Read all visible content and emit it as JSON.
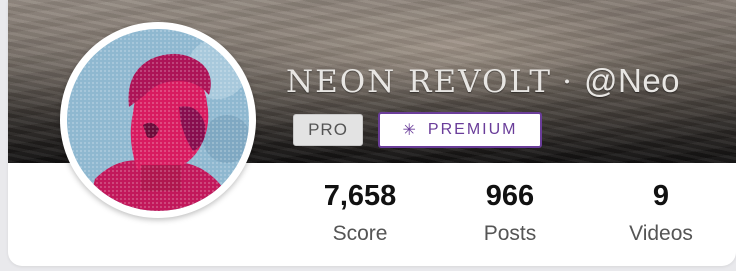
{
  "profile": {
    "display_name": "NEON REVOLT",
    "separator": "·",
    "handle": "@Neo",
    "avatar_icon": "statue-portrait-icon"
  },
  "badges": {
    "pro_label": "PRO",
    "premium_icon": "asterisk-icon",
    "premium_glyph": "✳",
    "premium_label": "PREMIUM"
  },
  "stats": [
    {
      "value": "7,658",
      "label": "Score"
    },
    {
      "value": "966",
      "label": "Posts"
    },
    {
      "value": "9",
      "label": "Videos"
    }
  ],
  "colors": {
    "premium_accent": "#6a3d9a",
    "avatar_tint": "#c2185b",
    "avatar_bg": "#8fb8d0"
  }
}
